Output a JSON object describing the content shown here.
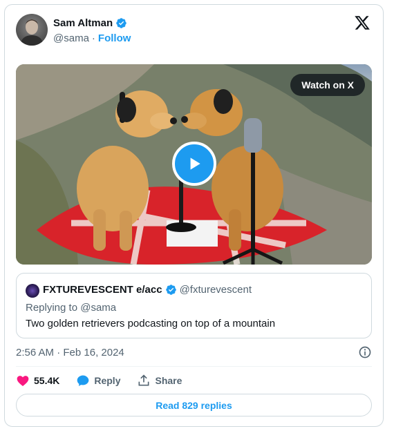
{
  "author": {
    "name": "Sam Altman",
    "handle": "@sama",
    "separator": "·",
    "follow_label": "Follow"
  },
  "media": {
    "watch_label": "Watch on X"
  },
  "quoted": {
    "name": "FXTUREVESCENT e/acc",
    "handle": "@fxturevescent",
    "replying_prefix": "Replying to",
    "replying_handle": "@sama",
    "text": "Two golden retrievers podcasting on top of a mountain"
  },
  "timestamp": "2:56 AM · Feb 16, 2024",
  "actions": {
    "likes": "55.4K",
    "reply_label": "Reply",
    "share_label": "Share"
  },
  "read_replies_label": "Read 829 replies",
  "colors": {
    "accent": "#1d9bf0",
    "like": "#f91880",
    "text": "#0f1419",
    "muted": "#536471",
    "border": "#cfd9de"
  },
  "icons": [
    "verified-badge-icon",
    "x-logo-icon",
    "play-icon",
    "info-icon",
    "heart-icon",
    "reply-bubble-icon",
    "share-icon"
  ]
}
